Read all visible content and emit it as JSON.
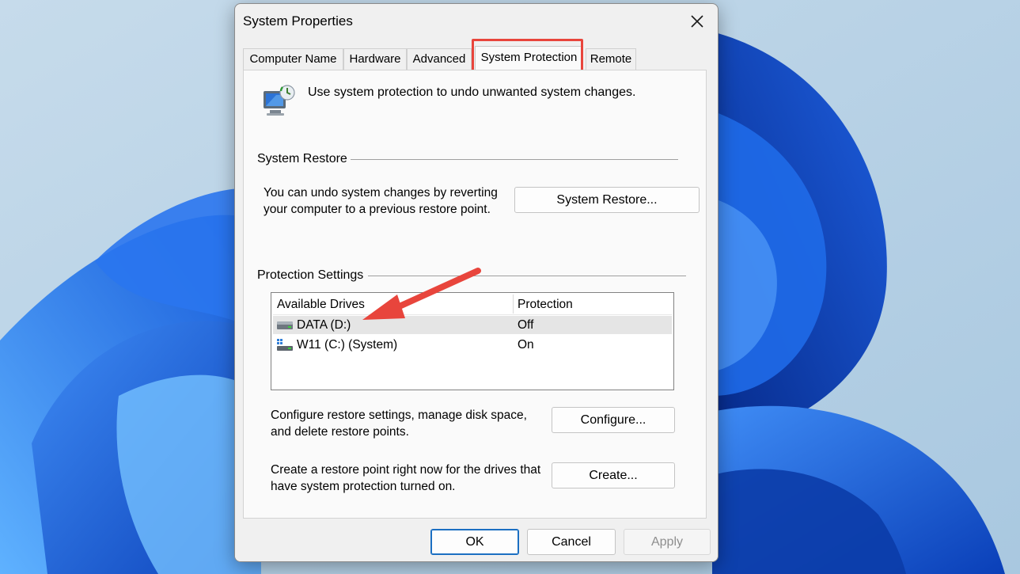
{
  "window": {
    "title": "System Properties"
  },
  "tabs": [
    {
      "label": "Computer Name"
    },
    {
      "label": "Hardware"
    },
    {
      "label": "Advanced"
    },
    {
      "label": "System Protection"
    },
    {
      "label": "Remote"
    }
  ],
  "active_tab": "System Protection",
  "header": {
    "text": "Use system protection to undo unwanted system changes."
  },
  "system_restore": {
    "group_label": "System Restore",
    "description_line1": "You can undo system changes by reverting",
    "description_line2": "your computer to a previous restore point.",
    "button_label": "System Restore..."
  },
  "protection_settings": {
    "group_label": "Protection Settings",
    "columns": {
      "drives": "Available Drives",
      "protection": "Protection"
    },
    "drives": [
      {
        "name": "DATA (D:)",
        "protection": "Off",
        "icon": "drive-icon"
      },
      {
        "name": "W11 (C:) (System)",
        "protection": "On",
        "icon": "system-drive-icon"
      }
    ],
    "configure_text_line1": "Configure restore settings, manage disk space,",
    "configure_text_line2": "and delete restore points.",
    "configure_label": "Configure...",
    "create_text_line1": "Create a restore point right now for the drives that",
    "create_text_line2": "have system protection turned on.",
    "create_label": "Create..."
  },
  "footer": {
    "ok_label": "OK",
    "cancel_label": "Cancel",
    "apply_label": "Apply"
  },
  "colors": {
    "highlight": "#e8453c",
    "accent": "#1b6fc2"
  }
}
